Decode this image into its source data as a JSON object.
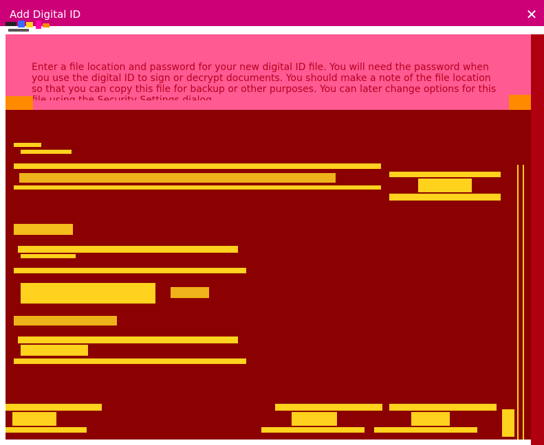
{
  "window": {
    "title": "Add Digital ID",
    "close_glyph": "✕"
  },
  "info": {
    "line1": "Enter a file location and password for your new digital ID file. You will need the password when",
    "line2": "you use the digital ID to sign or decrypt documents. You should make a note of the file location",
    "line3": "so that you can copy this file for backup or other purposes. You can later change options for this",
    "line4": "file using the Security Settings dialog."
  },
  "colors": {
    "titlebar": "#cc0077",
    "info_panel": "#ff5a92",
    "main_panel": "#8b0000",
    "glitch_stripes": "#ffd21e"
  },
  "icons": {
    "close": "close-icon"
  }
}
